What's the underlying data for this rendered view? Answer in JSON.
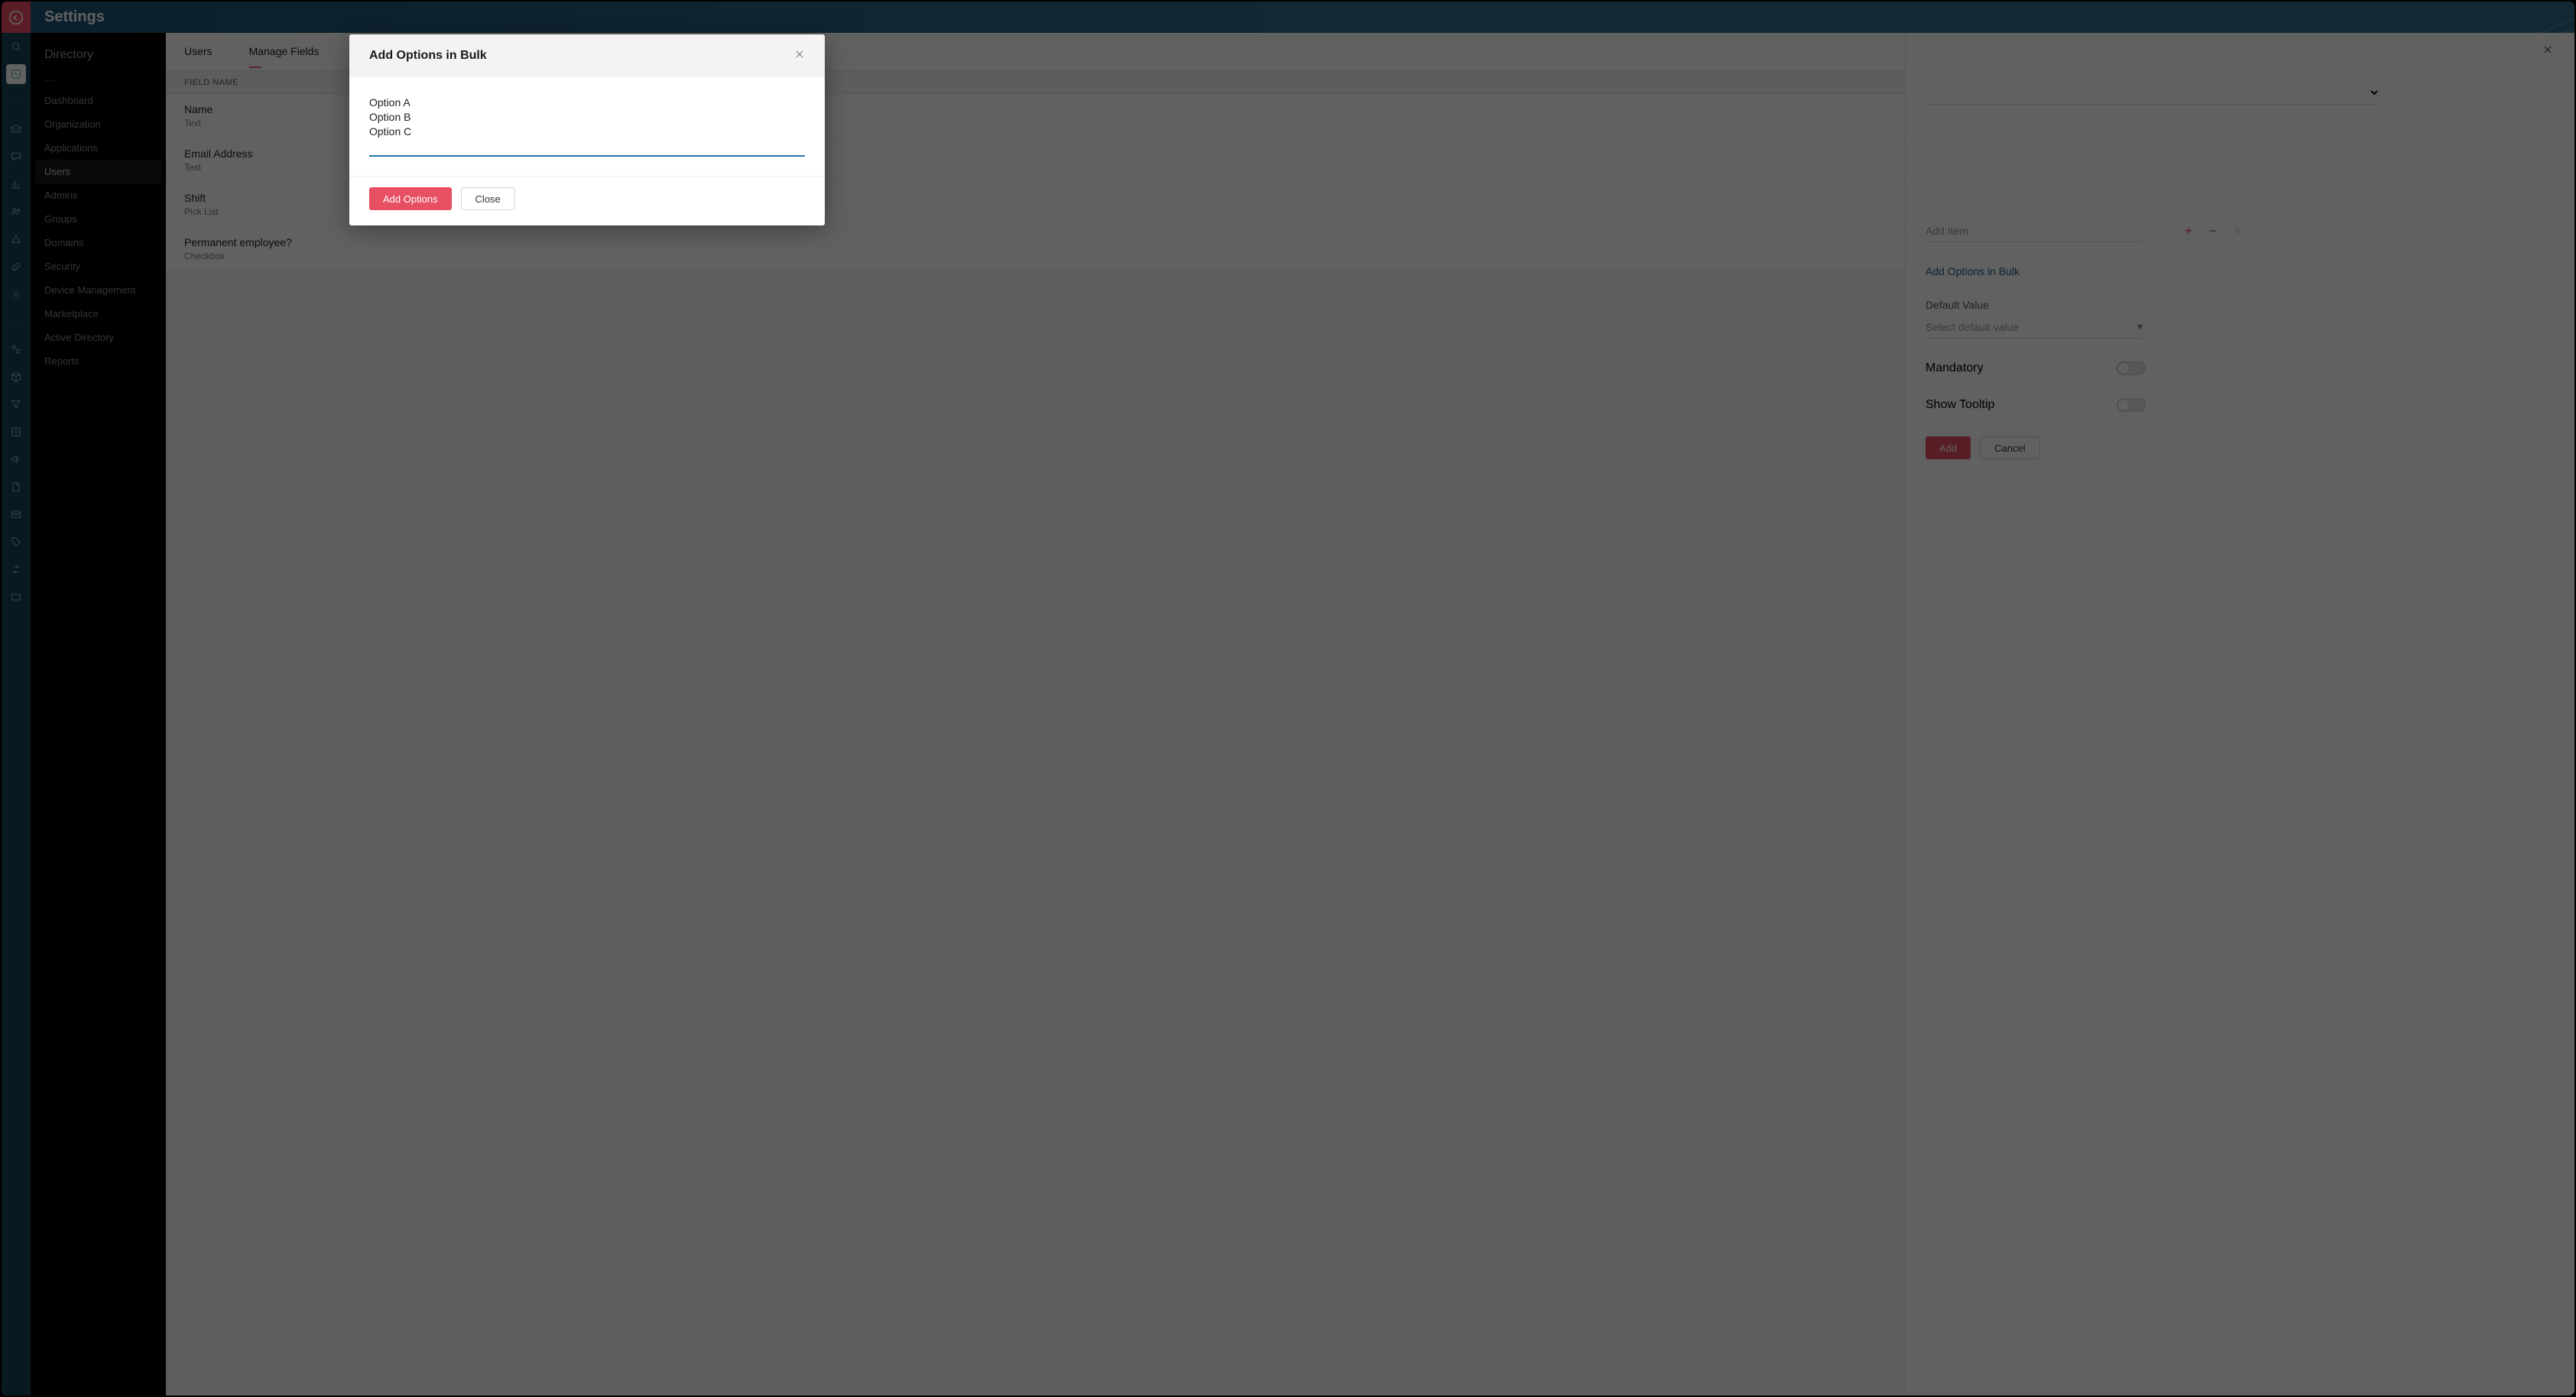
{
  "header": {
    "title": "Settings"
  },
  "rail": {
    "items": [
      {
        "name": "search-icon"
      },
      {
        "name": "app-icon",
        "active": true
      },
      {
        "name": "dash"
      },
      {
        "name": "mail-icon"
      },
      {
        "name": "chat-icon"
      },
      {
        "name": "chart-icon"
      },
      {
        "name": "people-icon"
      },
      {
        "name": "triangle-icon"
      },
      {
        "name": "link-icon"
      },
      {
        "name": "gear-plus-icon"
      },
      {
        "name": "dash"
      },
      {
        "name": "shapes-icon"
      },
      {
        "name": "cube-icon"
      },
      {
        "name": "filter-icon"
      },
      {
        "name": "refresh-box-icon"
      },
      {
        "name": "megaphone-icon"
      },
      {
        "name": "note-icon"
      },
      {
        "name": "envelope-icon"
      },
      {
        "name": "tag-icon"
      },
      {
        "name": "swap-icon"
      },
      {
        "name": "folder-icon"
      }
    ]
  },
  "sidebar": {
    "title": "Directory",
    "items": [
      {
        "label": "Dashboard",
        "name": "sidebar-item-dashboard"
      },
      {
        "label": "Organization",
        "name": "sidebar-item-organization"
      },
      {
        "label": "Applications",
        "name": "sidebar-item-applications"
      },
      {
        "label": "Users",
        "name": "sidebar-item-users",
        "active": true
      },
      {
        "label": "Admins",
        "name": "sidebar-item-admins"
      },
      {
        "label": "Groups",
        "name": "sidebar-item-groups"
      },
      {
        "label": "Domains",
        "name": "sidebar-item-domains"
      },
      {
        "label": "Security",
        "name": "sidebar-item-security"
      },
      {
        "label": "Device Management",
        "name": "sidebar-item-device-management"
      },
      {
        "label": "Marketplace",
        "name": "sidebar-item-marketplace"
      },
      {
        "label": "Active Directory",
        "name": "sidebar-item-active-directory"
      },
      {
        "label": "Reports",
        "name": "sidebar-item-reports"
      }
    ]
  },
  "main": {
    "tabs": [
      {
        "label": "Users",
        "name": "tab-users"
      },
      {
        "label": "Manage Fields",
        "name": "tab-manage-fields",
        "active": true
      }
    ],
    "column_header": "FIELD NAME",
    "fields": [
      {
        "name": "Name",
        "type": "Text"
      },
      {
        "name": "Email Address",
        "type": "Text"
      },
      {
        "name": "Shift",
        "type": "Pick List"
      },
      {
        "name": "Permanent employee?",
        "type": "Checkbox"
      }
    ]
  },
  "drawer": {
    "add_item_placeholder": "Add Item",
    "bulk_link": "Add Options in Bulk",
    "default_value_label": "Default Value",
    "default_value_placeholder": "Select default value",
    "mandatory_label": "Mandatory",
    "tooltip_label": "Show Tooltip",
    "add_button": "Add",
    "cancel_button": "Cancel"
  },
  "modal": {
    "title": "Add Options in Bulk",
    "textarea_value": "Option A\nOption B\nOption C",
    "add_button": "Add Options",
    "close_button": "Close"
  }
}
